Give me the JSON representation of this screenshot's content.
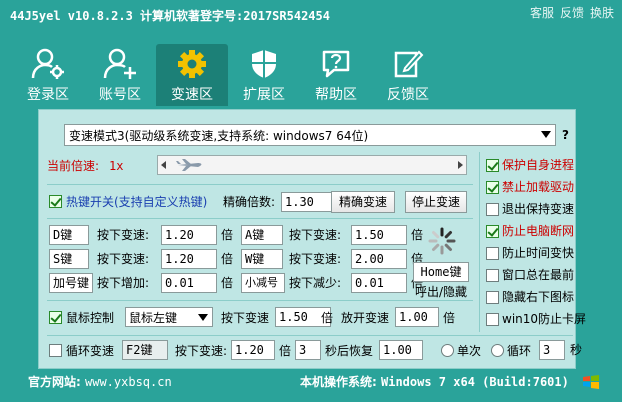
{
  "window": {
    "title": "44J5yel v10.8.2.3  计算机软著登字号:2017SR542454",
    "actions": [
      "客服",
      "反馈",
      "换肤"
    ]
  },
  "tabs": [
    {
      "label": "登录区",
      "icon": "user-gear-icon"
    },
    {
      "label": "账号区",
      "icon": "user-add-icon"
    },
    {
      "label": "变速区",
      "icon": "gear-icon"
    },
    {
      "label": "扩展区",
      "icon": "shield-icon"
    },
    {
      "label": "帮助区",
      "icon": "help-icon"
    },
    {
      "label": "反馈区",
      "icon": "edit-icon"
    }
  ],
  "active_tab": "变速区",
  "mode_select": {
    "value": "变速模式3(驱动级系统变速,支持系统: windows7 64位)",
    "help": "?"
  },
  "speed": {
    "label": "当前倍速:",
    "value": "1x",
    "slider_fraction": 0.0
  },
  "hotkey": {
    "toggle_label": "热键开关(支持自定义热键)",
    "precise_label": "精确倍数:",
    "precise_value": "1.30",
    "precise_btn": "精确变速",
    "stop_btn": "停止变速"
  },
  "keys": [
    {
      "key": "D键",
      "action": "按下变速:",
      "value": "1.20",
      "unit": "倍"
    },
    {
      "key": "A键",
      "action": "按下变速:",
      "value": "1.50",
      "unit": "倍"
    },
    {
      "key": "S键",
      "action": "按下变速:",
      "value": "1.20",
      "unit": "倍"
    },
    {
      "key": "W键",
      "action": "按下变速:",
      "value": "2.00",
      "unit": "倍"
    },
    {
      "key": "加号键",
      "action": "按下增加:",
      "value": "0.01",
      "unit": "倍"
    },
    {
      "key": "小减号键",
      "action": "按下减少:",
      "value": "0.01",
      "unit": "倍"
    }
  ],
  "home": {
    "key": "Home键",
    "label": "呼出/隐藏"
  },
  "mouse": {
    "label": "鼠标控制",
    "button": "鼠标左键",
    "press_label": "按下变速",
    "press_value": "1.50",
    "release_label": "放开变速",
    "release_value": "1.00",
    "unit": "倍"
  },
  "loop": {
    "label": "循环变速",
    "key": "F2键",
    "press_label": "按下变速:",
    "press_value": "1.20",
    "unit": "倍",
    "seconds": "3",
    "restore_label": "秒后恢复",
    "restore_value": "1.00",
    "once_label": "单次",
    "loop_label": "循环",
    "loop_seconds": "3",
    "sec_unit": "秒"
  },
  "options": [
    {
      "label": "保护自身进程",
      "checked": true,
      "color": "#cc0000"
    },
    {
      "label": "禁止加载驱动",
      "checked": true,
      "color": "#cc0000"
    },
    {
      "label": "退出保持变速",
      "checked": false,
      "color": "#000000"
    },
    {
      "label": "防止电脑断网",
      "checked": true,
      "color": "#cc0000"
    },
    {
      "label": "防止时间变快",
      "checked": false,
      "color": "#000000"
    },
    {
      "label": "窗口总在最前",
      "checked": false,
      "color": "#000000"
    },
    {
      "label": "隐藏右下图标",
      "checked": false,
      "color": "#000000"
    },
    {
      "label": "win10防止卡屏",
      "checked": false,
      "color": "#000000"
    }
  ],
  "footer": {
    "site_label": "官方网站:",
    "site_url": "www.yxbsq.cn",
    "os_label": "本机操作系统:",
    "os_value": "Windows 7 x64 (Build:7601)"
  },
  "colors": {
    "bg": "#2aa39a",
    "panel": "#bfe6e4",
    "accent_red": "#cc0000",
    "link_blue": "#1a3fb0"
  }
}
